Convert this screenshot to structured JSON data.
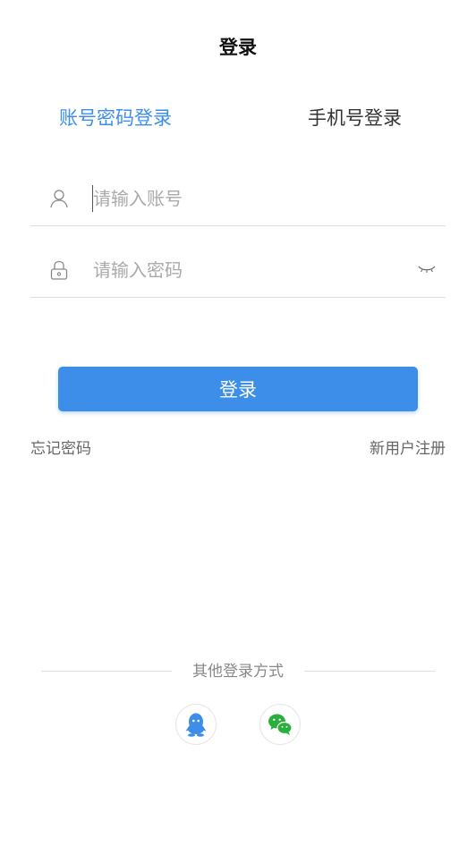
{
  "header": {
    "title": "登录"
  },
  "tabs": {
    "account_label": "账号密码登录",
    "phone_label": "手机号登录"
  },
  "form": {
    "account_placeholder": "请输入账号",
    "account_value": "",
    "password_placeholder": "请输入密码",
    "password_value": ""
  },
  "actions": {
    "login_label": "登录",
    "forgot_label": "忘记密码",
    "register_label": "新用户注册"
  },
  "social": {
    "divider_label": "其他登录方式",
    "items": [
      {
        "icon": "qq-icon"
      },
      {
        "icon": "wechat-icon"
      }
    ]
  },
  "colors": {
    "accent": "#3d8ee8",
    "text": "#333333",
    "placeholder": "#aaaaaa",
    "qq": "#3d8ee8",
    "wechat": "#2aae3e"
  }
}
